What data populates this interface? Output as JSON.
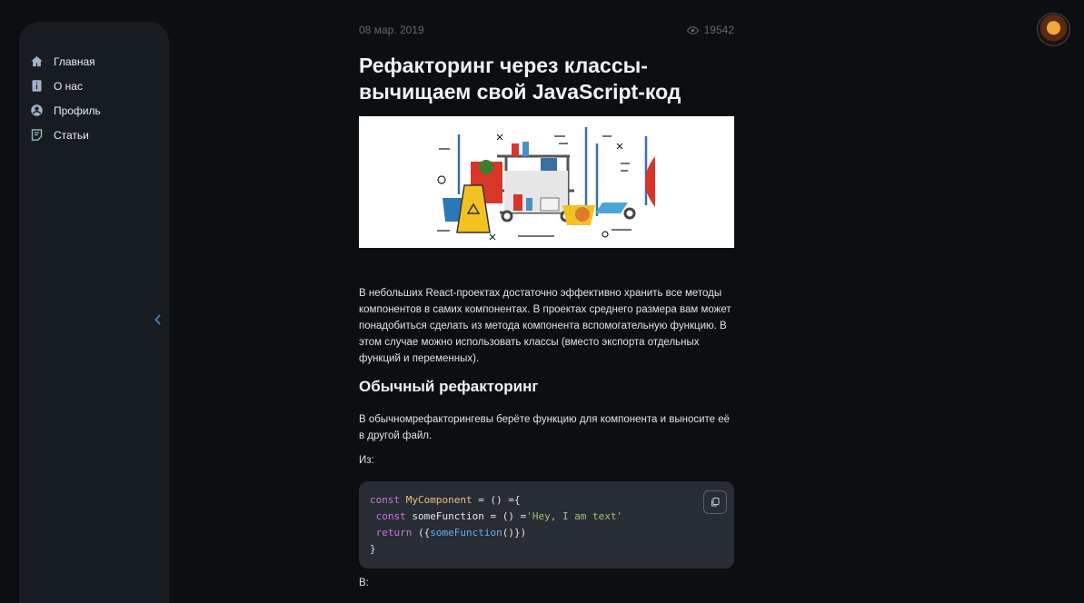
{
  "nav": {
    "items": [
      {
        "label": "Главная",
        "icon": "home-icon"
      },
      {
        "label": "О нас",
        "icon": "info-icon"
      },
      {
        "label": "Профиль",
        "icon": "profile-icon"
      },
      {
        "label": "Статьи",
        "icon": "articles-icon"
      }
    ]
  },
  "article": {
    "date": "08 мар. 2019",
    "views": "19542",
    "title": "Рефакторинг через классы- вычищаем свой JavaScript-код",
    "intro": "В небольших React-проектах достаточно эффективно хранить все методы компонентов в самих компонентах. В проектах среднего размера вам может понадобиться сделать из метода компонента вспомогательную функцию. В этом случае можно использовать классы (вместо экспорта отдельных функций и переменных).",
    "section_title": "Обычный рефакторинг",
    "section_text": "В обычномрефакторингевы берёте функцию для компонента и выносите её в другой файл.",
    "from_label": "Из:",
    "next_label": "В:",
    "code": {
      "l1_kw": "const",
      "l1_name": "MyComponent",
      "l1_rest": " = () ={",
      "l2_kw": "const",
      "l2_mid": " someFunction = () =",
      "l2_str": "'Hey, I am text'",
      "l3_kw": "return",
      "l3_a": " ({",
      "l3_call": "someFunction",
      "l3_b": "()})",
      "l4": "}"
    }
  },
  "colors": {
    "background": "#0b0f12",
    "sidebar": "#171c21",
    "code_bg": "#282c34",
    "icon": "#9fb3c8"
  }
}
